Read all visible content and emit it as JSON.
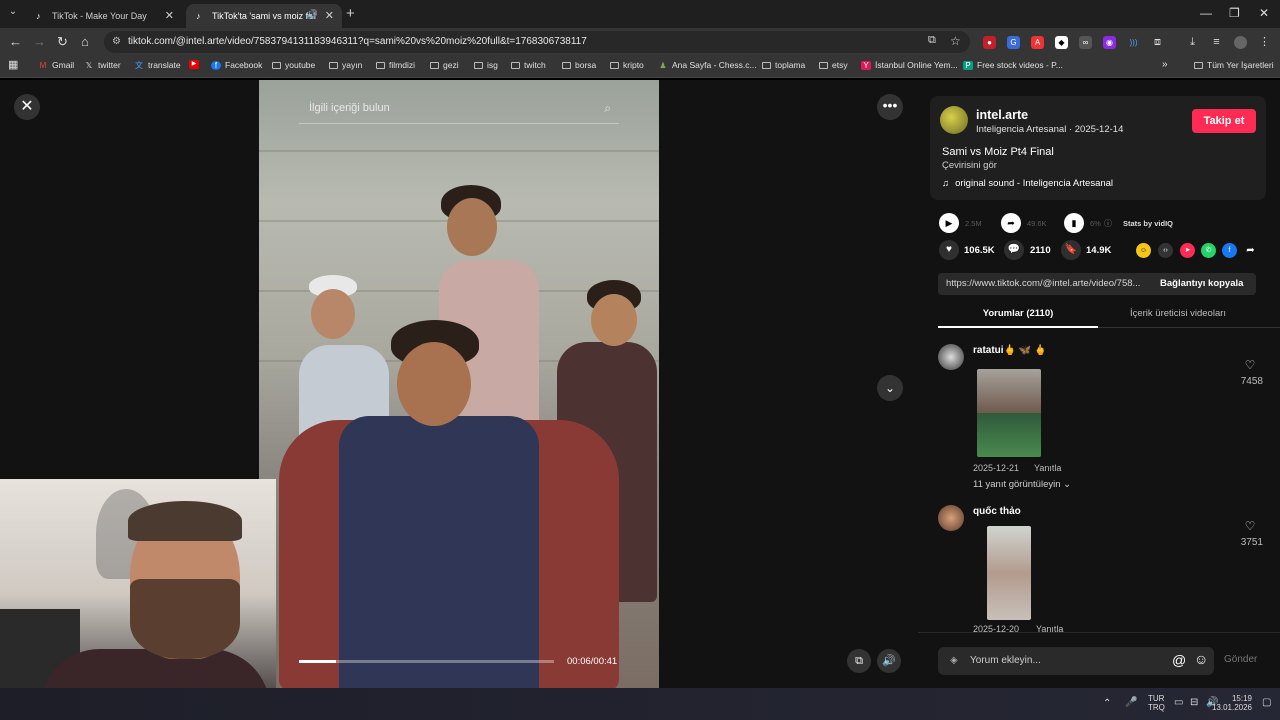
{
  "browser": {
    "tabs": [
      {
        "title": "TikTok - Make Your Day",
        "active": false
      },
      {
        "title": "TikTok'ta 'sami vs moiz full'",
        "active": true
      }
    ],
    "url": "tiktok.com/@intel.arte/video/7583794131183946311?q=sami%20vs%20moiz%20full&t=1768306738117",
    "bookmarks": [
      {
        "label": "Gmail",
        "icon": "gmail-icon"
      },
      {
        "label": "twitter",
        "icon": "x-icon"
      },
      {
        "label": "translate",
        "icon": "translate-icon"
      },
      {
        "label": "",
        "icon": "youtube-icon"
      },
      {
        "label": "Facebook",
        "icon": "facebook-icon"
      },
      {
        "label": "youtube",
        "icon": "folder-icon"
      },
      {
        "label": "yayın",
        "icon": "folder-icon"
      },
      {
        "label": "filmdizi",
        "icon": "folder-icon"
      },
      {
        "label": "gezi",
        "icon": "folder-icon"
      },
      {
        "label": "isg",
        "icon": "folder-icon"
      },
      {
        "label": "twitch",
        "icon": "folder-icon"
      },
      {
        "label": "borsa",
        "icon": "folder-icon"
      },
      {
        "label": "kripto",
        "icon": "folder-icon"
      },
      {
        "label": "Ana Sayfa - Chess.c...",
        "icon": "chess-icon"
      },
      {
        "label": "toplama",
        "icon": "folder-icon"
      },
      {
        "label": "etsy",
        "icon": "folder-icon"
      },
      {
        "label": "İstanbul Online Yem...",
        "icon": "yemek-icon"
      },
      {
        "label": "Free stock videos - P...",
        "icon": "pexels-icon"
      }
    ],
    "all_bookmarks": "Tüm Yer İşaretleri"
  },
  "video": {
    "search_placeholder": "İlgili içeriği bulun",
    "time": "00:06/00:41",
    "progress": 0.146
  },
  "author": {
    "handle": "intel.arte",
    "subtitle": "Inteligencia Artesanal · 2025-12-14",
    "follow": "Takip et",
    "title": "Sami vs Moiz Pt4 Final",
    "translate": "Çevirisini gör",
    "sound": "original sound - Inteligencia Artesanal"
  },
  "vidiq": {
    "views": "2.5M",
    "shares": "49.6K",
    "percent": "6%",
    "label": "Stats by vidIQ"
  },
  "stats": {
    "likes": "106.5K",
    "comments": "2110",
    "saves": "14.9K"
  },
  "link": {
    "url": "https://www.tiktok.com/@intel.arte/video/758...",
    "copy": "Bağlantıyı kopyala"
  },
  "tabs": {
    "comments": "Yorumlar (2110)",
    "creator": "İçerik üreticisi videoları"
  },
  "comments": [
    {
      "user": "ratatui🖕 🦋 🖕",
      "date": "2025-12-21",
      "reply": "Yanıtla",
      "likes": "7458",
      "replies": "11 yanıt görüntüleyin"
    },
    {
      "user": "quốc thảo",
      "date": "2025-12-20",
      "reply": "Yanıtla",
      "likes": "3751"
    }
  ],
  "comment_box": {
    "placeholder": "Yorum ekleyin...",
    "send": "Gönder"
  },
  "taskbar": {
    "lang_top": "TUR",
    "lang_bottom": "TRQ",
    "time": "15:19",
    "date": "13.01.2026"
  },
  "colors": {
    "accent": "#fe2c55",
    "background": "#121212"
  }
}
